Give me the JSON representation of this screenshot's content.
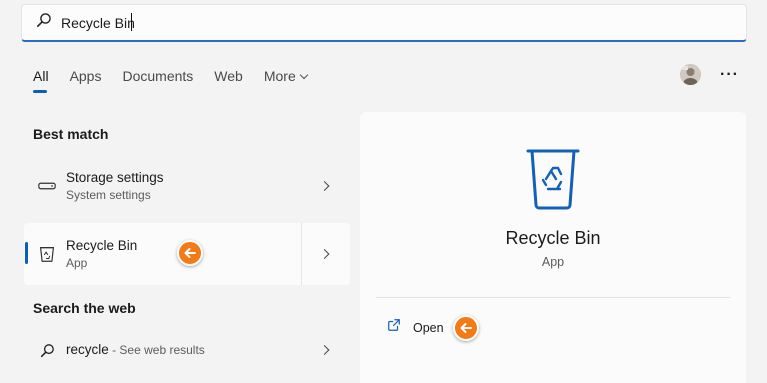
{
  "search": {
    "query": "Recycle Bin",
    "icon": "search-icon"
  },
  "tabs": [
    {
      "label": "All",
      "active": true
    },
    {
      "label": "Apps"
    },
    {
      "label": "Documents"
    },
    {
      "label": "Web"
    },
    {
      "label": "More"
    }
  ],
  "header_right": {
    "avatar": "user-avatar",
    "more_menu": "···"
  },
  "best_match": {
    "title": "Best match",
    "items": [
      {
        "title": "Storage settings",
        "subtitle": "System settings",
        "icon": "storage-drive-icon"
      },
      {
        "title": "Recycle Bin",
        "subtitle": "App",
        "icon": "recycle-bin-icon",
        "selected": true
      }
    ]
  },
  "web": {
    "title": "Search the web",
    "item": {
      "query": "recycle",
      "suffix": " - See web results",
      "icon": "search-icon"
    }
  },
  "detail": {
    "name": "Recycle Bin",
    "kind": "App",
    "actions": [
      {
        "label": "Open",
        "icon": "open-external-icon"
      }
    ]
  },
  "colors": {
    "accent": "#0a5fbd",
    "marker": "#f47a16",
    "app_icon": "#1260b8"
  }
}
